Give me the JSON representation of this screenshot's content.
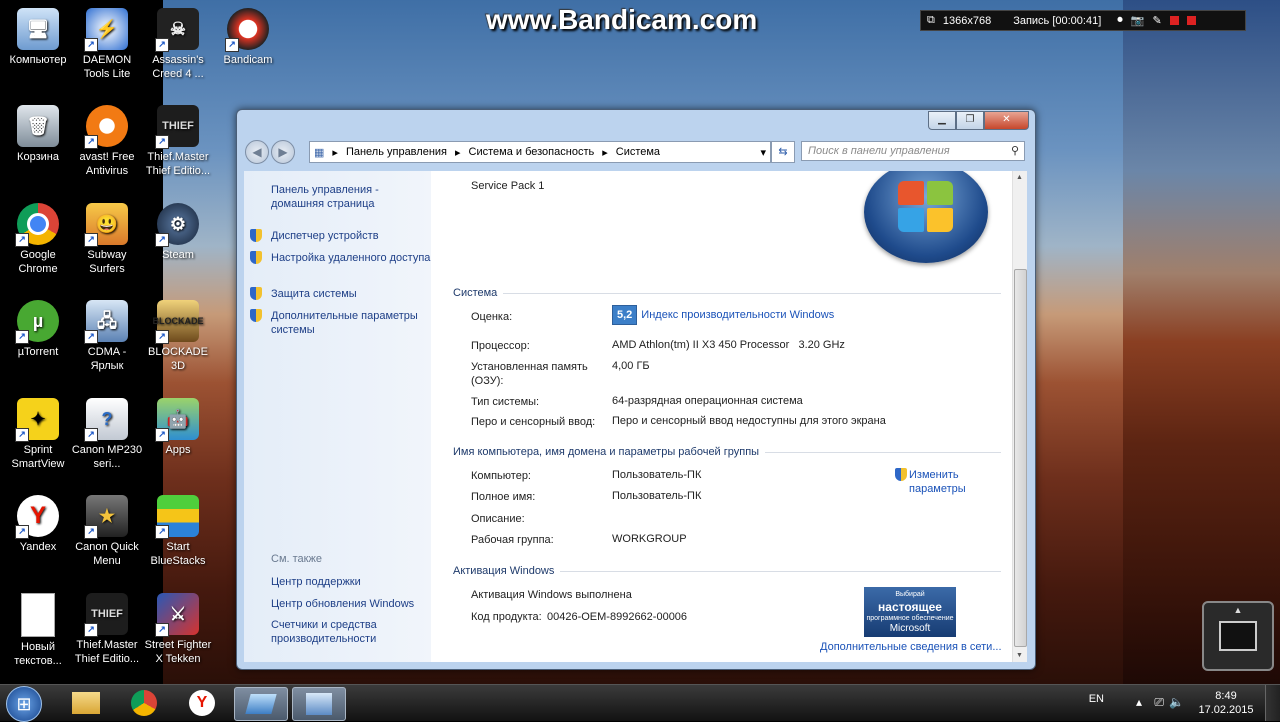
{
  "watermark": "www.Bandicam.com",
  "recorder": {
    "resolution": "1366x768",
    "recording": "Запись [00:00:41]"
  },
  "desktop_icons": [
    {
      "label": "Компьютер"
    },
    {
      "label": "DAEMON Tools Lite"
    },
    {
      "label": "Assassin's Creed 4 ..."
    },
    {
      "label": "Bandicam"
    },
    {
      "label": "Корзина"
    },
    {
      "label": "avast! Free Antivirus"
    },
    {
      "label": "Thief.Master Thief Editio..."
    },
    {
      "label": "Google Chrome"
    },
    {
      "label": "Subway Surfers"
    },
    {
      "label": "Steam"
    },
    {
      "label": "µTorrent"
    },
    {
      "label": "CDMA - Ярлык"
    },
    {
      "label": "BLOCKADE 3D"
    },
    {
      "label": "Sprint SmartView"
    },
    {
      "label": "Canon MP230 seri..."
    },
    {
      "label": "Apps"
    },
    {
      "label": "Yandex"
    },
    {
      "label": "Canon Quick Menu"
    },
    {
      "label": "Start BlueStacks"
    },
    {
      "label": "Новый текстов..."
    },
    {
      "label": "Thief.Master Thief Editio..."
    },
    {
      "label": "Street Fighter X Tekken"
    }
  ],
  "window": {
    "breadcrumb": [
      "Панель управления",
      "Система и безопасность",
      "Система"
    ],
    "search_placeholder": "Поиск в панели управления",
    "left_pane": {
      "home": "Панель управления - домашняя страница",
      "tasks": [
        "Диспетчер устройств",
        "Настройка удаленного доступа",
        "Защита системы",
        "Дополнительные параметры системы"
      ],
      "see_also_title": "См. также",
      "see_also": [
        "Центр поддержки",
        "Центр обновления Windows",
        "Счетчики и средства производительности"
      ]
    },
    "service_pack": "Service Pack 1",
    "system_section": {
      "title": "Система",
      "rating_label": "Оценка:",
      "rating_value": "5,2",
      "rating_link": "Индекс производительности Windows",
      "processor_label": "Процессор:",
      "processor_value": "AMD Athlon(tm) II X3 450 Processor   3.20 GHz",
      "ram_label": "Установленная память (ОЗУ):",
      "ram_value": "4,00 ГБ",
      "type_label": "Тип системы:",
      "type_value": "64-разрядная операционная система",
      "pen_label": "Перо и сенсорный ввод:",
      "pen_value": "Перо и сенсорный ввод недоступны для этого экрана"
    },
    "computer_section": {
      "title": "Имя компьютера, имя домена и параметры рабочей группы",
      "computer_label": "Компьютер:",
      "computer_value": "Пользователь-ПК",
      "fullname_label": "Полное имя:",
      "fullname_value": "Пользователь-ПК",
      "desc_label": "Описание:",
      "workgroup_label": "Рабочая группа:",
      "workgroup_value": "WORKGROUP",
      "change_link": "Изменить параметры"
    },
    "activation_section": {
      "title": "Активация Windows",
      "status": "Активация Windows выполнена",
      "product_key_label": "Код продукта:",
      "product_key_value": "00426-OEM-8992662-00006",
      "badge_top": "Выбирай",
      "badge_main": "настоящее",
      "badge_sub": "программное обеспечение",
      "badge_brand": "Microsoft",
      "more_link": "Дополнительные сведения в сети..."
    }
  },
  "taskbar": {
    "lang": "EN",
    "time": "8:49",
    "date": "17.02.2015"
  }
}
